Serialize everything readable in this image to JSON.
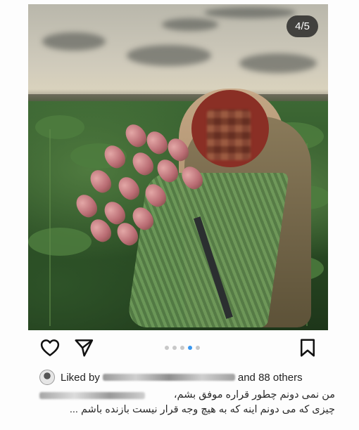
{
  "post": {
    "image_counter": "4/5",
    "carousel": {
      "count": 5,
      "active_index": 3
    },
    "liked_by": {
      "prefix": "Liked by",
      "others": "and 88 others"
    },
    "caption": {
      "line1": "من نمی دونم چطور قراره موفق بشم،",
      "line2": "چیزی که می دونم اینه که به هیچ وجه قرار نیست بازنده باشم ..."
    }
  },
  "icons": {
    "like": "heart-icon",
    "share": "send-icon",
    "save": "bookmark-icon"
  },
  "colors": {
    "active_dot": "#3897f0",
    "inactive_dot": "#c8c8c8",
    "counter_bg": "#1e1e1e"
  }
}
